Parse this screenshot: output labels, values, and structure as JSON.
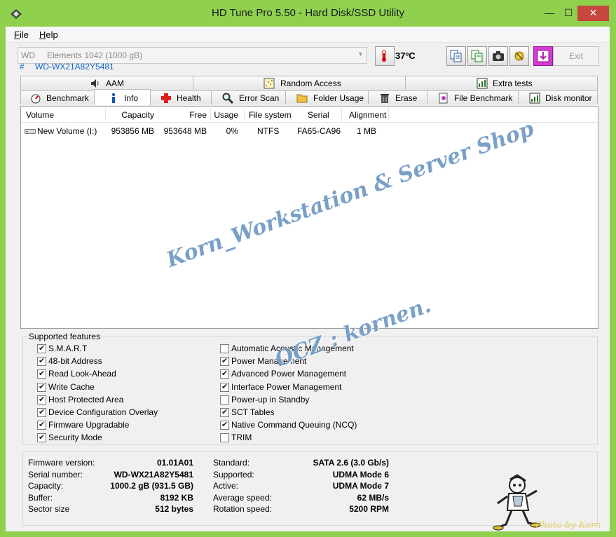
{
  "window": {
    "title": "HD Tune Pro 5.50 - Hard Disk/SSD Utility",
    "minimize": "—",
    "maximize": "☐",
    "close": "✕"
  },
  "menu": [
    {
      "label": "File",
      "accel": "F"
    },
    {
      "label": "Help",
      "accel": "H"
    }
  ],
  "drive": {
    "vendor": "WD",
    "model": "Elements 1042 (1000 gB)",
    "serial_hash": "#",
    "serial": "WD-WX21A82Y5481"
  },
  "temperature": "37ºC",
  "exit_label": "Exit",
  "tabs_top": [
    {
      "label": "AAM",
      "icon": "speaker-icon"
    },
    {
      "label": "Random Access",
      "icon": "random-access-icon"
    },
    {
      "label": "Extra tests",
      "icon": "extra-tests-icon"
    }
  ],
  "tabs_bottom": [
    {
      "label": "Benchmark",
      "icon": "benchmark-icon"
    },
    {
      "label": "Info",
      "icon": "info-icon",
      "active": true
    },
    {
      "label": "Health",
      "icon": "health-cross-icon"
    },
    {
      "label": "Error Scan",
      "icon": "magnifier-icon"
    },
    {
      "label": "Folder Usage",
      "icon": "folder-icon"
    },
    {
      "label": "Erase",
      "icon": "trash-icon"
    },
    {
      "label": "File Benchmark",
      "icon": "file-benchmark-icon"
    },
    {
      "label": "Disk monitor",
      "icon": "disk-monitor-icon"
    }
  ],
  "volumes": {
    "columns": [
      "Volume",
      "Capacity",
      "Free",
      "Usage",
      "File system",
      "Serial",
      "Alignment"
    ],
    "rows": [
      {
        "volume": "New Volume (I:)",
        "capacity": "953856 MB",
        "free": "953648 MB",
        "usage": "0%",
        "fs": "NTFS",
        "serial": "FA65-CA96",
        "alignment": "1 MB"
      }
    ]
  },
  "watermark": {
    "line1": "Korn_Workstation & Server Shop",
    "line2": "OCZ : kornen."
  },
  "features": {
    "title": "Supported features",
    "left": [
      {
        "label": "S.M.A.R.T",
        "checked": true
      },
      {
        "label": "48-bit Address",
        "checked": true
      },
      {
        "label": "Read Look-Ahead",
        "checked": true
      },
      {
        "label": "Write Cache",
        "checked": true
      },
      {
        "label": "Host Protected Area",
        "checked": true
      },
      {
        "label": "Device Configuration Overlay",
        "checked": true
      },
      {
        "label": "Firmware Upgradable",
        "checked": true
      },
      {
        "label": "Security Mode",
        "checked": true
      }
    ],
    "right": [
      {
        "label": "Automatic Acoustic Management",
        "checked": false
      },
      {
        "label": "Power Management",
        "checked": true
      },
      {
        "label": "Advanced Power Management",
        "checked": true
      },
      {
        "label": "Interface Power Management",
        "checked": true
      },
      {
        "label": "Power-up in Standby",
        "checked": false
      },
      {
        "label": "SCT Tables",
        "checked": true
      },
      {
        "label": "Native Command Queuing (NCQ)",
        "checked": true
      },
      {
        "label": "TRIM",
        "checked": false
      }
    ]
  },
  "info": {
    "left": [
      {
        "label": "Firmware version:",
        "value": "01.01A01"
      },
      {
        "label": "Serial number:",
        "value": "WD-WX21A82Y5481"
      },
      {
        "label": "Capacity:",
        "value": "1000.2 gB (931.5 GB)"
      },
      {
        "label": "Buffer:",
        "value": "8192 KB"
      },
      {
        "label": "Sector size",
        "value": "512 bytes"
      }
    ],
    "right": [
      {
        "label": "Standard:",
        "value": "SATA 2.6 (3.0 Gb/s)"
      },
      {
        "label": "Supported:",
        "value": "UDMA Mode 6"
      },
      {
        "label": "Active:",
        "value": "UDMA Mode 7"
      },
      {
        "label": "Average speed:",
        "value": "62 MB/s"
      },
      {
        "label": "Rotation speed:",
        "value": "5200 RPM"
      }
    ]
  },
  "credit": "Photo by Korn",
  "colors": {
    "window_frame": "#8fd14f",
    "close_button": "#c7463d",
    "serial_text": "#1a66cc",
    "watermark": "#7aa0c8"
  }
}
